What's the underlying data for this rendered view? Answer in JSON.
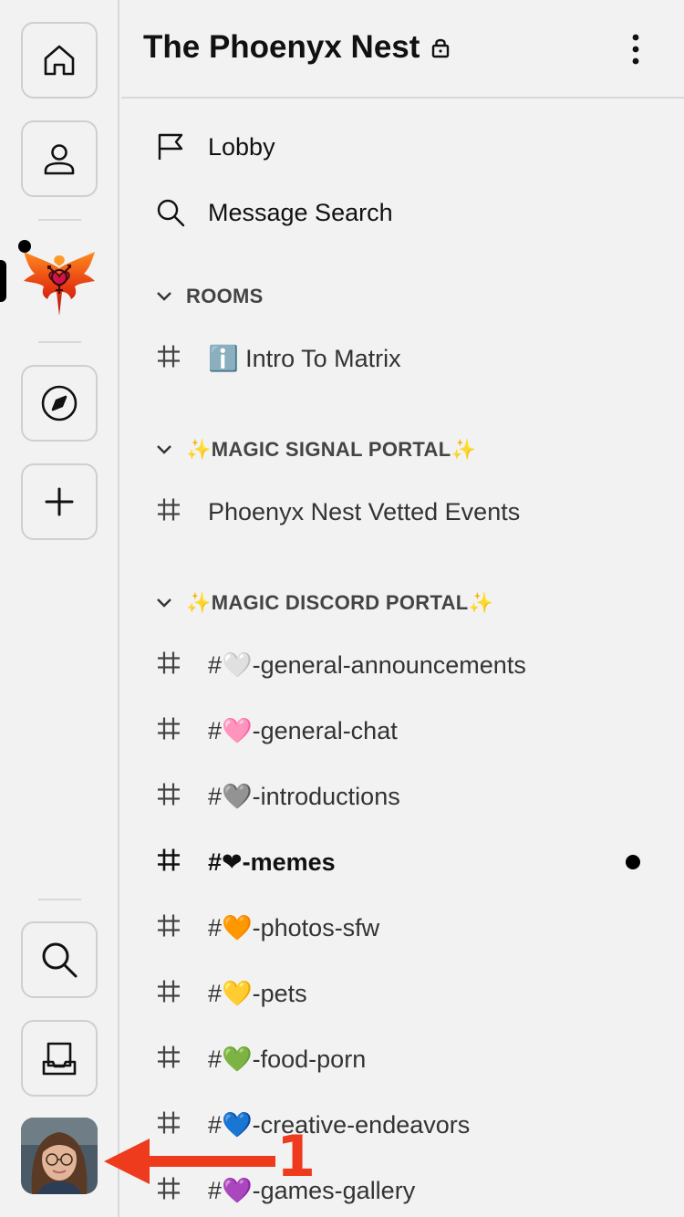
{
  "header": {
    "title": "The Phoenyx Nest"
  },
  "nav": [
    {
      "label": "Lobby",
      "icon": "flag-icon"
    },
    {
      "label": "Message Search",
      "icon": "search-icon"
    }
  ],
  "sections": [
    {
      "label": "ROOMS",
      "rooms": [
        "ℹ️ Intro To Matrix"
      ]
    },
    {
      "label": "✨MAGIC SIGNAL PORTAL✨",
      "rooms": [
        "Phoenyx Nest Vetted Events"
      ]
    },
    {
      "label": "✨MAGIC DISCORD PORTAL✨",
      "rooms": [
        "#🤍-general-announcements",
        "#🩷-general-chat",
        "#🩶-introductions",
        "#❤-memes",
        "#🧡-photos-sfw",
        "#💛-pets",
        "#💚-food-porn",
        "#💙-creative-endeavors",
        "#💜-games-gallery"
      ]
    }
  ],
  "annotation": {
    "label": "1",
    "color": "#ee3b1e"
  },
  "colors": {
    "background": "#f2f2f2",
    "border": "#d8d8d8",
    "unread": "#000000"
  }
}
